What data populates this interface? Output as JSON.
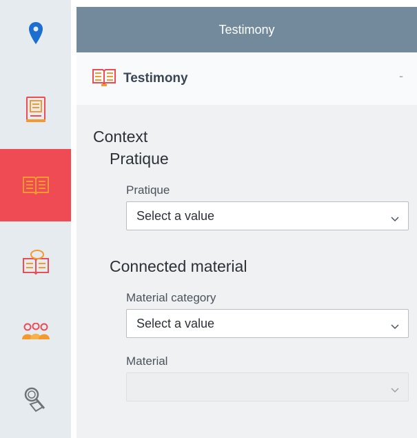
{
  "header": {
    "title": "Testimony"
  },
  "section": {
    "title": "Testimony",
    "collapse_label": "-"
  },
  "form": {
    "context_title": "Context",
    "pratique_group_title": "Pratique",
    "pratique_label": "Pratique",
    "pratique_value": "Select a value",
    "connected_title": "Connected material",
    "material_category_label": "Material category",
    "material_category_value": "Select a value",
    "material_label": "Material",
    "material_value": ""
  },
  "sidebar": {
    "items": [
      {
        "icon": "location-pin-icon",
        "active": false
      },
      {
        "icon": "document-book-icon",
        "active": false
      },
      {
        "icon": "open-book-icon",
        "active": true
      },
      {
        "icon": "book-speech-icon",
        "active": false
      },
      {
        "icon": "people-group-icon",
        "active": false
      },
      {
        "icon": "magnifier-search-icon",
        "active": false
      }
    ]
  },
  "colors": {
    "topbar": "#738a9c",
    "active": "#ef4b55",
    "rail": "#e6ebef",
    "icon_orange": "#f39a2e",
    "pin_blue": "#1c6fd1"
  }
}
